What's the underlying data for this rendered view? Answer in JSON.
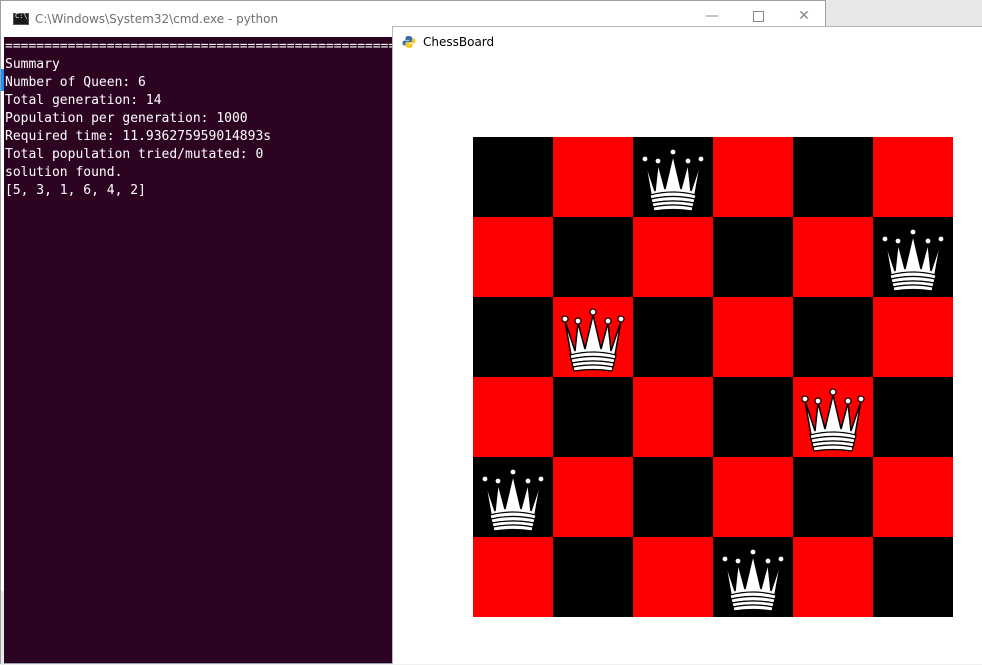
{
  "cmd": {
    "title": "C:\\Windows\\System32\\cmd.exe - python",
    "separator": "================================================================================================",
    "lines": [
      "Summary",
      "Number of Queen: 6",
      "Total generation: 14",
      "Population per generation: 1000",
      "Required time: 11.936275959014893s",
      "Total population tried/mutated: 0",
      "solution found.",
      "[5, 3, 1, 6, 4, 2]"
    ],
    "background_color": "#2c0421"
  },
  "chessboard": {
    "title": "ChessBoard",
    "size": 6,
    "queen_rows_by_column": [
      5,
      3,
      1,
      6,
      4,
      2
    ],
    "colors": {
      "light": "#ff0000",
      "dark": "#000000",
      "queen": "#ffffff"
    },
    "icon": "python-icon"
  }
}
